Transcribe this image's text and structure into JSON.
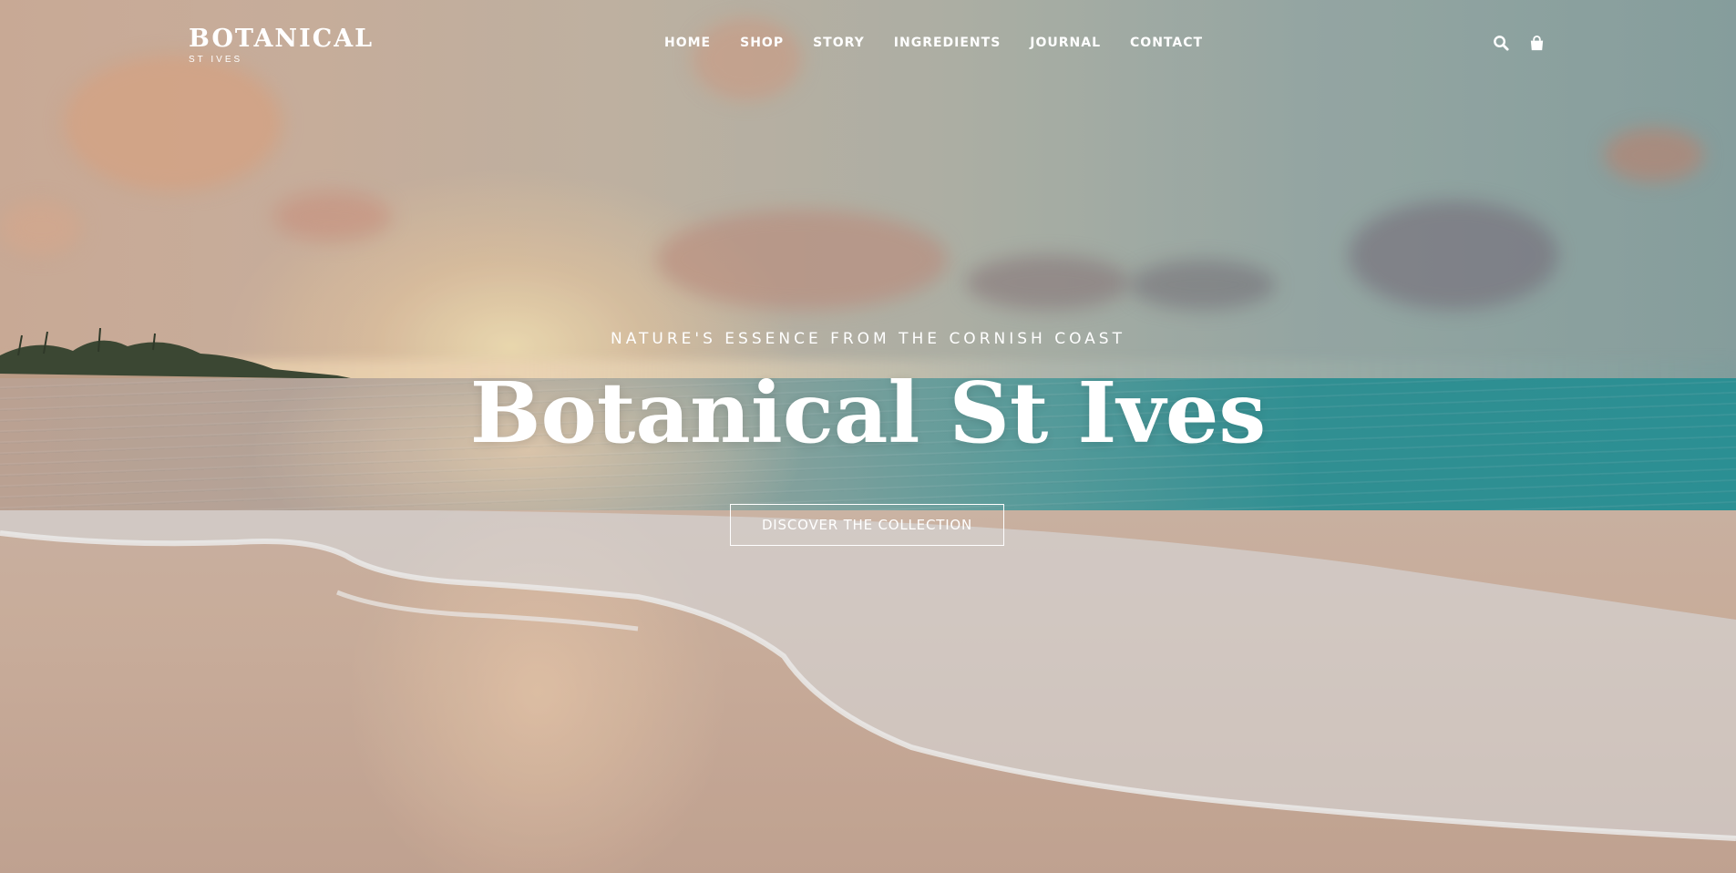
{
  "brand": {
    "name": "BOTANICAL",
    "location": "ST IVES"
  },
  "nav": {
    "items": [
      "HOME",
      "SHOP",
      "STORY",
      "INGREDIENTS",
      "JOURNAL",
      "CONTACT"
    ]
  },
  "header_icons": [
    "search-icon",
    "shopping-bag-icon"
  ],
  "hero": {
    "tagline": "NATURE'S ESSENCE FROM THE CORNISH COAST",
    "title": "Botanical St Ives",
    "cta_label": "DISCOVER THE COLLECTION"
  },
  "colors": {
    "text": "#ffffff",
    "sea_accent": "#2a9aa0",
    "sand": "#d7b9a6"
  }
}
